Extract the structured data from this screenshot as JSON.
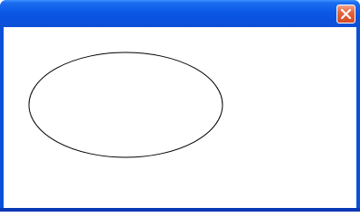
{
  "window": {
    "title": "",
    "accent_color": "#0a58e6",
    "close_button": {
      "icon": "close-icon",
      "color": "#e3643f"
    }
  },
  "canvas": {
    "background": "#ffffff",
    "shapes": [
      {
        "type": "ellipse",
        "stroke": "#000000",
        "fill": "none"
      }
    ]
  }
}
